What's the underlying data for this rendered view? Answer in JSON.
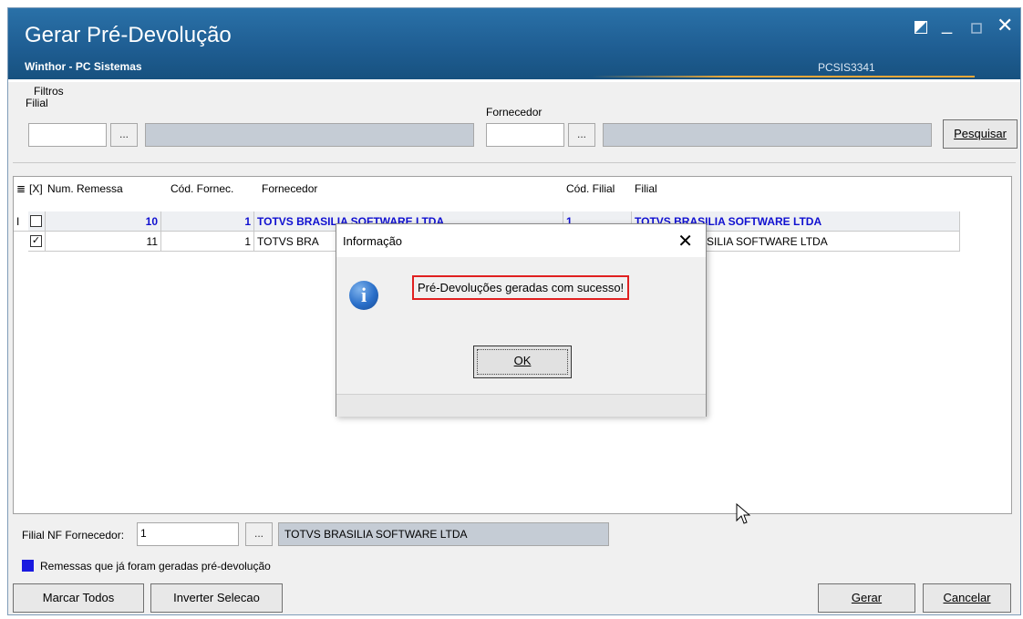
{
  "window": {
    "title": "Gerar Pré-Devolução",
    "subtitle": "Winthor - PC Sistemas",
    "code": "PCSIS3341"
  },
  "filters": {
    "group_label": "Filtros",
    "filial_label": "Filial",
    "filial_value": "",
    "fornecedor_label": "Fornecedor",
    "fornecedor_value": "",
    "ellipsis": "...",
    "search_button": "Pesquisar"
  },
  "grid": {
    "headers": {
      "menu": "≣",
      "select": "[X]",
      "num_remessa": "Num. Remessa",
      "cod_fornec": "Cód. Fornec.",
      "fornecedor": "Fornecedor",
      "cod_filial": "Cód. Filial",
      "filial": "Filial"
    },
    "rows": [
      {
        "indicator": "I",
        "checked": false,
        "num_remessa": "10",
        "cod_fornec": "1",
        "fornecedor": "TOTVS BRASILIA SOFTWARE LTDA",
        "cod_filial": "1",
        "filial": "TOTVS BRASILIA SOFTWARE LTDA"
      },
      {
        "indicator": "",
        "checked": true,
        "num_remessa": "11",
        "cod_fornec": "1",
        "fornecedor": "TOTVS BRA",
        "cod_filial": "",
        "filial": "SILIA SOFTWARE LTDA"
      }
    ]
  },
  "dialog": {
    "title": "Informação",
    "message": "Pré-Devoluções geradas com sucesso!",
    "ok_label": "OK"
  },
  "footer": {
    "filial_nf_label": "Filial NF Fornecedor:",
    "filial_nf_value": "1",
    "filial_nf_name": "TOTVS BRASILIA SOFTWARE LTDA",
    "legend_text": "Remessas que já foram geradas pré-devolução",
    "marcar_todos": "Marcar Todos",
    "inverter_selecao": "Inverter Selecao",
    "gerar": "Gerar",
    "cancelar": "Cancelar"
  },
  "colors": {
    "titlebar": "#1f5e93",
    "highlight_text": "#1010d0",
    "legend_blue": "#1a1ae0",
    "message_border": "#e02020"
  },
  "icons": [
    "restore-icon",
    "minimize-icon",
    "maximize-icon",
    "close-icon",
    "info-icon",
    "mouse-pointer-icon"
  ]
}
